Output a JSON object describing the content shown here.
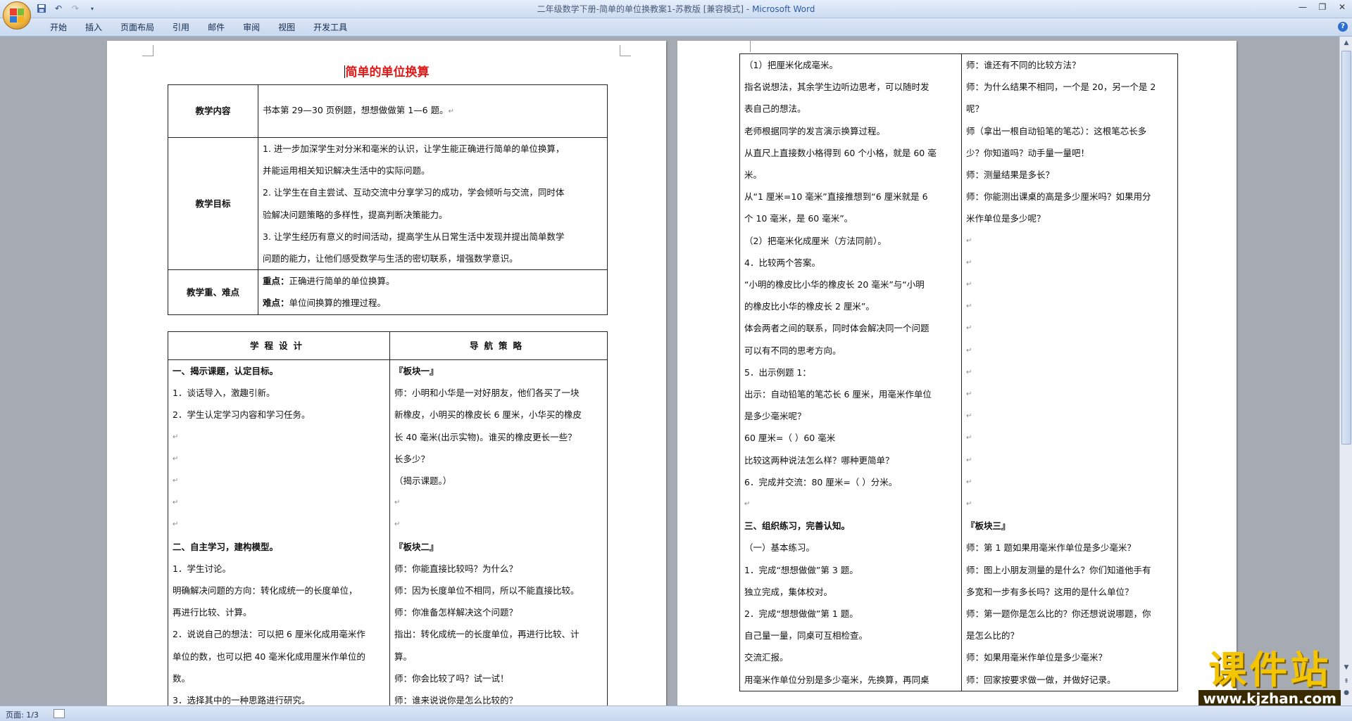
{
  "window": {
    "title": "二年级数学下册-简单的单位换教案1-苏教版 [兼容模式] - ",
    "app_name": "Microsoft Word"
  },
  "ribbon": {
    "tabs": [
      "开始",
      "插入",
      "页面布局",
      "引用",
      "邮件",
      "审阅",
      "视图",
      "开发工具"
    ]
  },
  "status": {
    "page": "页面: 1/3"
  },
  "watermark": {
    "main": "课件站",
    "url": "www.kjzhan.com"
  },
  "doc": {
    "title": "简单的单位换算",
    "rows": {
      "content": {
        "head": "教学内容",
        "text": "书本第 29—30 页例题，想想做做第 1—6 题。"
      },
      "goals": {
        "head": "教学目标",
        "lines": [
          "1. 进一步加深学生对分米和毫米的认识，让学生能正确进行简单的单位换算，",
          "并能运用相关知识解决生活中的实际问题。",
          "2. 让学生在自主尝试、互动交流中分享学习的成功，学会倾听与交流，同时体",
          "验解决问题策略的多样性，提高判断决策能力。",
          "3. 让学生经历有意义的时间活动，提高学生从日常生活中发现并提出简单数学",
          "问题的能力，让他们感受数学与生活的密切联系，增强数学意识。"
        ]
      },
      "key": {
        "head": "教学重、难点",
        "key_label": "重点：",
        "key_text": "正确进行简单的单位换算。",
        "diff_label": "难点：",
        "diff_text": "单位间换算的推理过程。"
      }
    },
    "col_left": "学程设计",
    "col_right": "导航策略",
    "left_col": [
      "一、揭示课题，认定目标。",
      "1．谈话导入，激趣引新。",
      "2．学生认定学习内容和学习任务。",
      "",
      "",
      "",
      "",
      "",
      "二、自主学习，建构模型。",
      "1．学生讨论。",
      "明确解决问题的方向：转化成统一的长度单位，",
      "再进行比较、计算。",
      "2．说说自己的想法：可以把 6 厘米化成用毫米作",
      "单位的数，也可以把 40 毫米化成用厘米作单位的",
      "数。",
      "3．选择其中的一种思路进行研究。"
    ],
    "right_col": [
      "『板块一』",
      "师：小明和小华是一对好朋友，他们各买了一块",
      "新橡皮，小明买的橡皮长 6 厘米，小华买的橡皮",
      "长 40 毫米(出示实物)。谁买的橡皮更长一些？",
      "长多少？",
      "（揭示课题。）",
      "",
      "",
      "『板块二』",
      "师：你能直接比较吗？为什么？",
      "师：因为长度单位不相同，所以不能直接比较。",
      "师：你准备怎样解决这个问题？",
      "指出：转化成统一的长度单位，再进行比较、计",
      "算。",
      "师：你会比较了吗？试一试！",
      "师：谁来说说你是怎么比较的？"
    ],
    "page2_left": [
      "（1）把厘米化成毫米。",
      "指名说想法，其余学生边听边思考，可以随时发",
      "表自己的想法。",
      "老师根据同学的发言演示换算过程。",
      "从直尺上直接数小格得到 60 个小格，就是 60 毫",
      "米。",
      "从“1 厘米=10 毫米”直接推想到“6 厘米就是 6",
      "个 10 毫米，是 60 毫米”。",
      "（2）把毫米化成厘米（方法同前）。",
      "4．比较两个答案。",
      "“小明的橡皮比小华的橡皮长 20 毫米”与“小明",
      "的橡皮比小华的橡皮长 2 厘米”。",
      "体会两者之间的联系，同时体会解决同一个问题",
      "可以有不同的思考方向。",
      "5．出示例题 1：",
      "出示：自动铅笔的笔芯长 6 厘米，用毫米作单位",
      "是多少毫米呢？",
      "60 厘米=（  ）60 毫米",
      "比较这两种说法怎么样？哪种更简单？",
      "6．完成并交流：80 厘米=（   ）分米。",
      "",
      "三、组织练习，完善认知。",
      "（一）基本练习。",
      "1．完成“想想做做”第 3 题。",
      "独立完成，集体校对。",
      "2．完成“想想做做”第 1 题。",
      "自己量一量，同桌可互相检查。",
      "交流汇报。",
      "用毫米作单位分别是多少毫米，先换算，再同桌"
    ],
    "page2_right": [
      "师：谁还有不同的比较方法？",
      "师：为什么结果不相同，一个是 20，另一个是 2",
      "呢？",
      "师（拿出一根自动铅笔的笔芯）：这根笔芯长多",
      "少？你知道吗？动手量一量吧！",
      "师：测量结果是多长？",
      "师：你能测出课桌的高是多少厘米吗？如果用分",
      "米作单位是多少呢？",
      "",
      "",
      "",
      "",
      "",
      "",
      "",
      "",
      "",
      "",
      "",
      "",
      "",
      "『板块三』",
      "师：第 1 题如果用毫米作单位是多少毫米？",
      "师：图上小朋友测量的是什么？你们知道他手有",
      "多宽和一步有多长吗？这用的是什么单位？",
      "师：第一题你是怎么比的？你还想说说哪题，你",
      "是怎么比的？",
      "师：如果用毫米作单位是多少毫米？",
      "师：回家按要求做一做，并做好记录。"
    ],
    "para_mark": "↵",
    "colors": {
      "title": "#e01818",
      "watermark": "#f3c400"
    }
  }
}
